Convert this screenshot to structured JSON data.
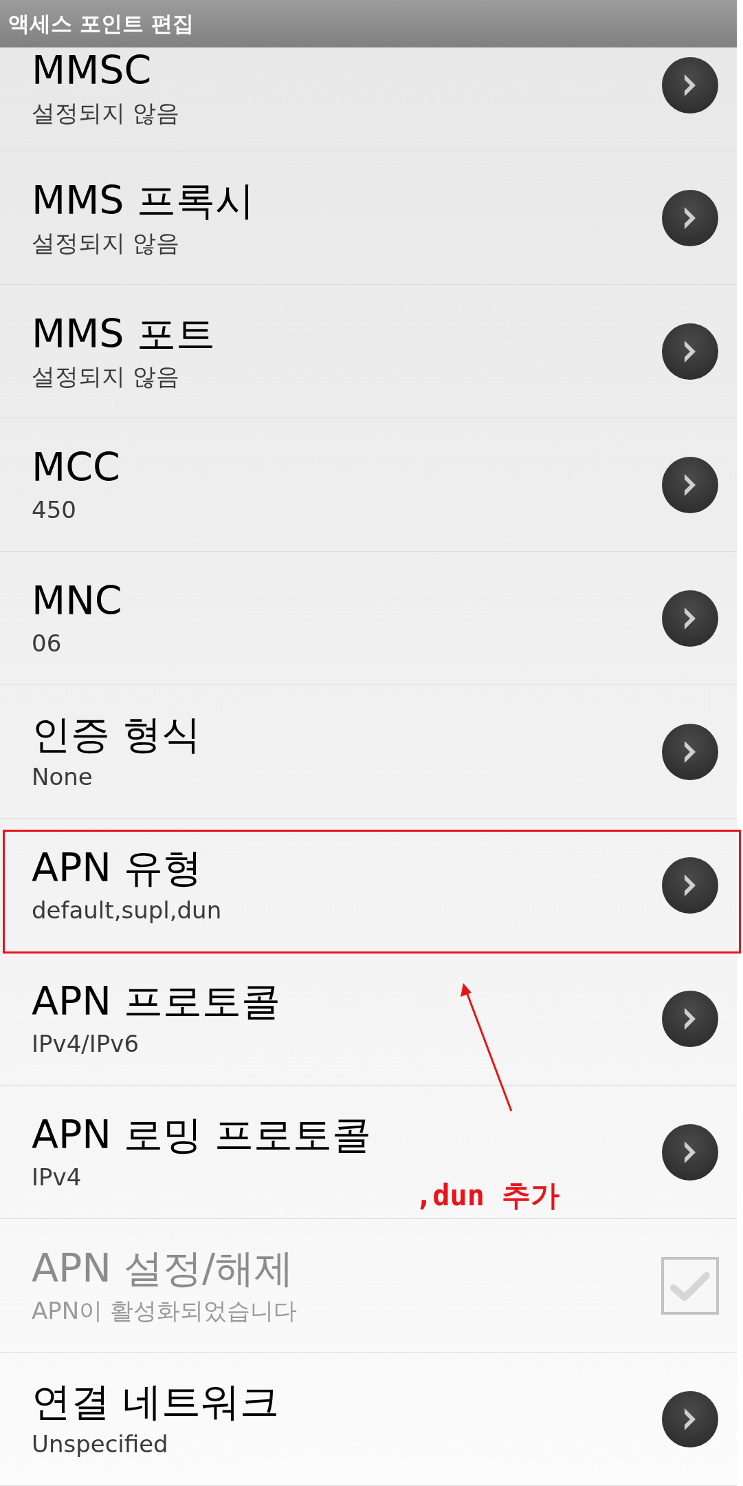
{
  "title_bar": {
    "title": "액세스 포인트 편집"
  },
  "rows": [
    {
      "title": "MMSC",
      "summary": "설정되지 않음",
      "kind": "chevron",
      "disabled": false,
      "highlighted": false
    },
    {
      "title": "MMS 프록시",
      "summary": "설정되지 않음",
      "kind": "chevron",
      "disabled": false,
      "highlighted": false
    },
    {
      "title": "MMS 포트",
      "summary": "설정되지 않음",
      "kind": "chevron",
      "disabled": false,
      "highlighted": false
    },
    {
      "title": "MCC",
      "summary": "450",
      "kind": "chevron",
      "disabled": false,
      "highlighted": false
    },
    {
      "title": "MNC",
      "summary": "06",
      "kind": "chevron",
      "disabled": false,
      "highlighted": false
    },
    {
      "title": "인증 형식",
      "summary": "None",
      "kind": "chevron",
      "disabled": false,
      "highlighted": false
    },
    {
      "title": "APN 유형",
      "summary": "default,supl,dun",
      "kind": "chevron",
      "disabled": false,
      "highlighted": true
    },
    {
      "title": "APN 프로토콜",
      "summary": "IPv4/IPv6",
      "kind": "chevron",
      "disabled": false,
      "highlighted": false
    },
    {
      "title": "APN 로밍 프로토콜",
      "summary": "IPv4",
      "kind": "chevron",
      "disabled": false,
      "highlighted": false
    },
    {
      "title": "APN 설정/해제",
      "summary": "APN이 활성화되었습니다",
      "kind": "checkbox",
      "disabled": true,
      "checked": true,
      "highlighted": false
    },
    {
      "title": "연결 네트워크",
      "summary": "Unspecified",
      "kind": "chevron",
      "disabled": false,
      "highlighted": false
    }
  ],
  "annotation": {
    "text": ",dun 추가"
  }
}
